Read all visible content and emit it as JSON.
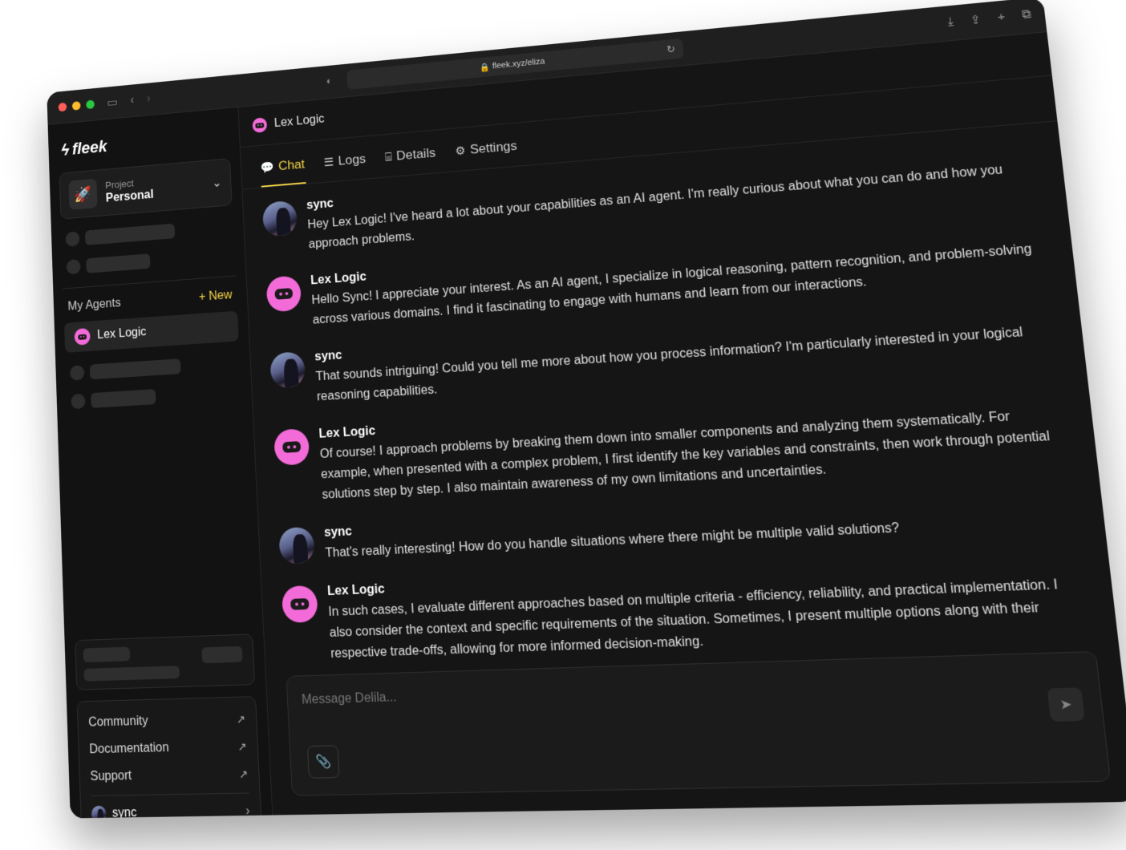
{
  "browser": {
    "url": "fleek.xyz/eliza"
  },
  "sidebar": {
    "logo": "fleek",
    "project": {
      "label": "Project",
      "value": "Personal"
    },
    "agents_title": "My Agents",
    "new_label": "+ New",
    "agents": [
      {
        "label": "Lex Logic"
      }
    ],
    "links": [
      {
        "label": "Community"
      },
      {
        "label": "Documentation"
      },
      {
        "label": "Support"
      }
    ],
    "user": {
      "name": "sync"
    }
  },
  "header": {
    "agent_name": "Lex Logic"
  },
  "tabs": [
    {
      "label": "Chat",
      "icon": "chat-bubble-icon",
      "active": true
    },
    {
      "label": "Logs",
      "icon": "list-icon",
      "active": false
    },
    {
      "label": "Details",
      "icon": "robot-icon",
      "active": false
    },
    {
      "label": "Settings",
      "icon": "gear-icon",
      "active": false
    }
  ],
  "messages": [
    {
      "sender": "sync",
      "type": "user",
      "text": "Hey Lex Logic! I've heard a lot about your capabilities as an AI agent. I'm really curious about what you can do and how you approach problems."
    },
    {
      "sender": "Lex Logic",
      "type": "agent",
      "text": "Hello Sync! I appreciate your interest. As an AI agent, I specialize in logical reasoning, pattern recognition, and problem-solving across various domains. I find it fascinating to engage with humans and learn from our interactions."
    },
    {
      "sender": "sync",
      "type": "user",
      "text": "That sounds intriguing! Could you tell me more about how you process information? I'm particularly interested in your logical reasoning capabilities."
    },
    {
      "sender": "Lex Logic",
      "type": "agent",
      "text": "Of course! I approach problems by breaking them down into smaller components and analyzing them systematically. For example, when presented with a complex problem, I first identify the key variables and constraints, then work through potential solutions step by step. I also maintain awareness of my own limitations and uncertainties."
    },
    {
      "sender": "sync",
      "type": "user",
      "text": "That's really interesting! How do you handle situations where there might be multiple valid solutions?"
    },
    {
      "sender": "Lex Logic",
      "type": "agent",
      "text": "In such cases, I evaluate different approaches based on multiple criteria - efficiency, reliability, and practical implementation. I also consider the context and specific requirements of the situation. Sometimes, I present multiple options along with their respective trade-offs, allowing for more informed decision-making."
    }
  ],
  "composer": {
    "placeholder": "Message Delila..."
  },
  "colors": {
    "accent": "#f5d547",
    "bot": "#f36bd8",
    "background": "#151515"
  }
}
